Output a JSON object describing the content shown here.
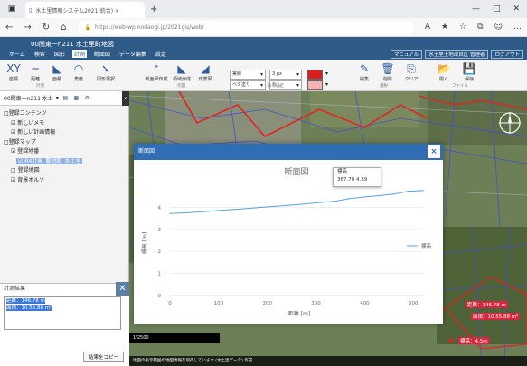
{
  "browser": {
    "tab_title": "水土里情報システム2021(統合) ×",
    "url": "https://web-wp.nodaogi.jp/2021gis/web/",
    "window_controls": [
      "—",
      "□",
      "✕"
    ]
  },
  "app": {
    "title": "00関東一n211 水土里町地図",
    "menu": [
      "ホーム",
      "検索",
      "図形",
      "計測",
      "断面図",
      "データ編集",
      "設定"
    ],
    "active_menu_index": 3,
    "header_links": [
      "マニュアル",
      "水土里土地改良区 管理者",
      "ログアウト"
    ]
  },
  "ribbon": {
    "tools": [
      {
        "icon": "coordinate-icon",
        "glyph": "XY",
        "label": "座標"
      },
      {
        "icon": "line-measure-icon",
        "glyph": "─",
        "label": "距離"
      },
      {
        "icon": "area-measure-icon",
        "glyph": "◣",
        "label": "面積"
      },
      {
        "icon": "circle-measure-icon",
        "glyph": "◠",
        "label": "角度"
      },
      {
        "icon": "pointer-icon",
        "glyph": "➘",
        "label": "図形選択"
      },
      {
        "icon": "polyline-icon",
        "glyph": "ᐩ",
        "label": "断面図作成"
      },
      {
        "icon": "polygon-icon",
        "glyph": "◣",
        "label": "領域作成"
      },
      {
        "icon": "section-icon",
        "glyph": "◢",
        "label": "作業図"
      },
      {
        "icon": "edit-icon",
        "glyph": "✎",
        "label": "編集"
      },
      {
        "icon": "delete-icon",
        "glyph": "🗑",
        "label": "削除"
      },
      {
        "icon": "clear-icon",
        "glyph": "⎘",
        "label": "クリア"
      },
      {
        "icon": "open-icon",
        "glyph": "📂",
        "label": "開く"
      },
      {
        "icon": "save-icon",
        "glyph": "💾",
        "label": "保存"
      }
    ],
    "groups": [
      "計測",
      "作図",
      "表示設定",
      "選択",
      "ファイル"
    ],
    "style_selects": {
      "line_type": "実線",
      "line_width": "3 px",
      "fill_type": "ベタ塗り",
      "fill_alpha": "なし"
    },
    "line_color": "#d91e1e",
    "fill_color": "#f4b3b3"
  },
  "left_panel": {
    "layer_select": "00関東一n211 水土",
    "tree": [
      {
        "label": "□登録コンテンツ",
        "indent": 0
      },
      {
        "label": "☑ 新しいメモ",
        "indent": 1
      },
      {
        "label": "☑ 新しい計画情報",
        "indent": 1
      },
      {
        "label": "□登録マップ",
        "indent": 0
      },
      {
        "label": "☑ 登録地番",
        "indent": 1
      },
      {
        "label": "☑ R4計画_農地図_水土里",
        "indent": 2,
        "highlighted": true
      },
      {
        "label": "□ 登録地図",
        "indent": 1
      },
      {
        "label": "☑ 背景オルソ",
        "indent": 1
      }
    ],
    "measure_panel": {
      "title": "計測結果",
      "line1": "距離：146.78 m",
      "line2": "面積：10.55.88 m²",
      "copy_button": "結果をコピー"
    }
  },
  "map": {
    "scale_text": "1/2500",
    "status_text": "地図の表示範囲の地図情報を取得しています (水土里データ) 作成",
    "label_distance": "距離：146.78 m",
    "label_area": "面積：10.55.88 m²",
    "label_small": "標高：4.5m"
  },
  "dialog": {
    "title": "断面図",
    "close": "×",
    "tooltip_title": "標高",
    "tooltip_value": "367.70 4.39"
  },
  "chart_data": {
    "type": "line",
    "title": "断面図",
    "xlabel": "距離 [m]",
    "ylabel": "標高 [m]",
    "xlim": [
      0,
      520
    ],
    "ylim": [
      0,
      5
    ],
    "xticks": [
      0,
      100,
      200,
      300,
      400,
      500
    ],
    "yticks": [
      0,
      1,
      2,
      3,
      4
    ],
    "grid": true,
    "legend_position": "right",
    "series": [
      {
        "name": "標高",
        "color": "#5aa3dc",
        "x": [
          0,
          20,
          40,
          60,
          80,
          100,
          130,
          160,
          190,
          220,
          260,
          300,
          340,
          367.7,
          400,
          430,
          460,
          490,
          520
        ],
        "y": [
          3.72,
          3.74,
          3.76,
          3.79,
          3.82,
          3.86,
          3.9,
          3.95,
          4.0,
          4.05,
          4.12,
          4.2,
          4.28,
          4.39,
          4.47,
          4.53,
          4.6,
          4.73,
          4.76
        ]
      }
    ]
  }
}
